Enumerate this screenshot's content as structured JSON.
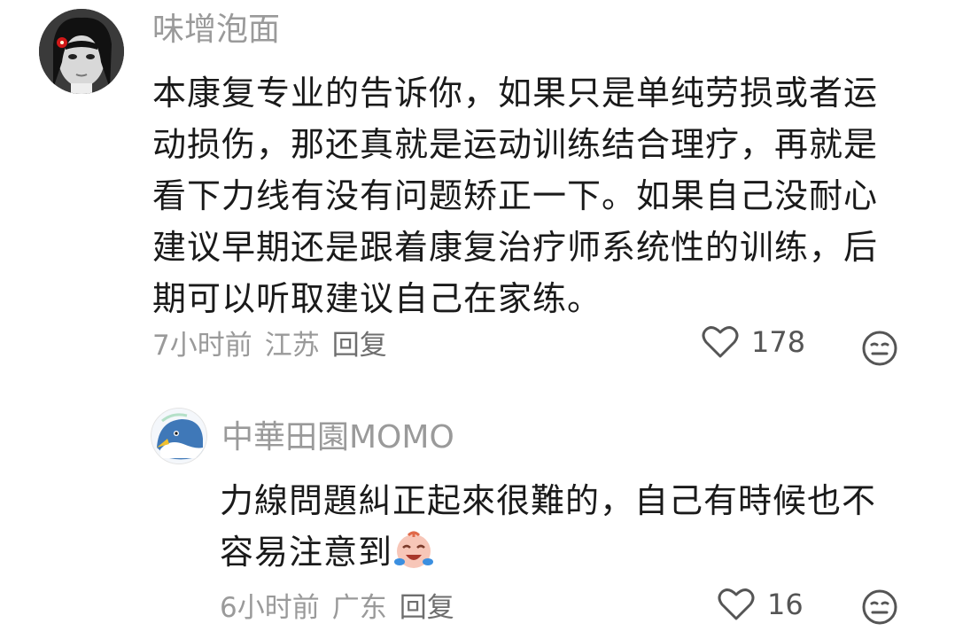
{
  "comments": [
    {
      "username": "味增泡面",
      "avatar": "woman-portrait-avatar",
      "text": "本康复专业的告诉你，如果只是单纯劳损或者运动损伤，那还真就是运动训练结合理疗，再就是看下力线有没有问题矫正一下。如果自己没耐心建议早期还是跟着康复治疗师系统性的训练，后期可以听取建议自己在家练。",
      "time": "7小时前",
      "location": "江苏",
      "reply_label": "回复",
      "likes": "178",
      "like_icon": "heart-outline-icon",
      "dislike_icon": "meh-face-icon"
    },
    {
      "username": "中華田園MOMO",
      "avatar": "cartoon-bird-avatar",
      "text": "力線問題糾正起來很難的，自己有時候也不容易注意到",
      "emoji": "crying-laugh-emoji",
      "time": "6小时前",
      "location": "广东",
      "reply_label": "回复",
      "likes": "16",
      "like_icon": "heart-outline-icon",
      "dislike_icon": "meh-face-icon"
    }
  ]
}
